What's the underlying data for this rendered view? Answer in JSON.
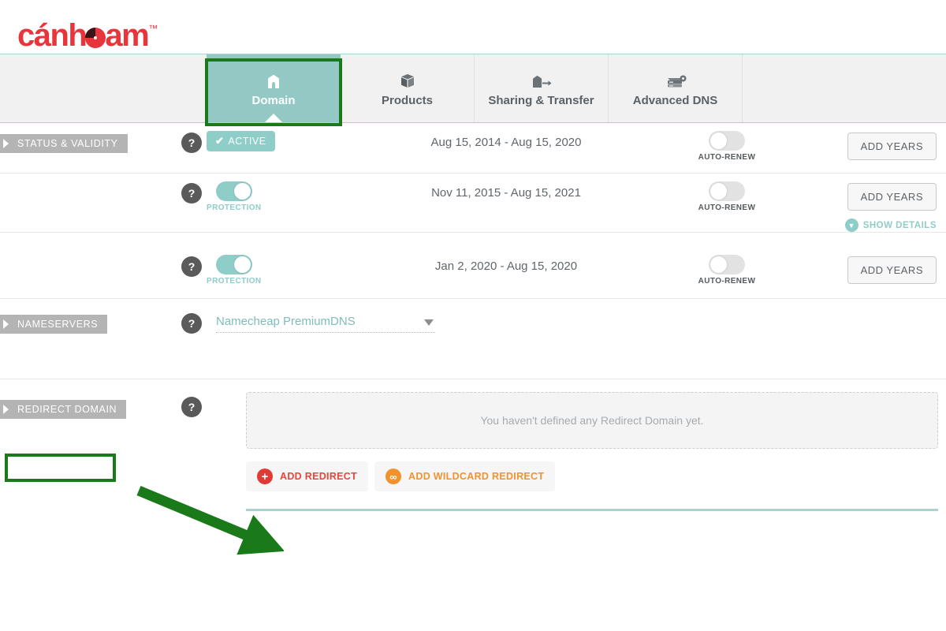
{
  "brand": {
    "name_before": "c",
    "name_accent_a": "ánh",
    "name_after": "am",
    "trademark": "™"
  },
  "tabs": [
    {
      "label": "Domain",
      "icon": "home-icon",
      "active": true
    },
    {
      "label": "Products",
      "icon": "box-icon",
      "active": false
    },
    {
      "label": "Sharing & Transfer",
      "icon": "house-arrow-icon",
      "active": false
    },
    {
      "label": "Advanced DNS",
      "icon": "server-gear-icon",
      "active": false
    }
  ],
  "sections": {
    "status": {
      "tag": "STATUS & VALIDITY",
      "help": "?",
      "rows": [
        {
          "badge": "ACTIVE",
          "check": "✔",
          "dates": "Aug 15, 2014 - Aug 15, 2020",
          "renew_label": "AUTO-RENEW",
          "renew_state": "off",
          "action": "ADD YEARS",
          "details": null
        },
        {
          "toggle_label": "PROTECTION",
          "toggle_state": "on",
          "dates": "Nov 11, 2015 - Aug 15, 2021",
          "renew_label": "AUTO-RENEW",
          "renew_state": "off",
          "action": "ADD YEARS",
          "details": "SHOW DETAILS"
        },
        {
          "toggle_label": "PROTECTION",
          "toggle_state": "on",
          "dates": "Jan 2, 2020 - Aug 15, 2020",
          "renew_label": "AUTO-RENEW",
          "renew_state": "off",
          "action": "ADD YEARS",
          "details": null
        }
      ]
    },
    "nameservers": {
      "tag": "NAMESERVERS",
      "help": "?",
      "selected": "Namecheap PremiumDNS"
    },
    "redirect": {
      "tag": "REDIRECT DOMAIN",
      "help": "?",
      "empty_message": "You haven't defined any Redirect Domain yet.",
      "add_redirect": "ADD REDIRECT",
      "add_wildcard": "ADD WILDCARD REDIRECT",
      "plus_icon": "+",
      "wildcard_icon": "∞"
    }
  },
  "colors": {
    "brand_red": "#e8353c",
    "teal": "#8fcdc8",
    "tab_active": "#93c8c5",
    "tag_gray": "#b4b4b4",
    "annotation_green": "#1a7a1a",
    "orange": "#f2922f"
  }
}
